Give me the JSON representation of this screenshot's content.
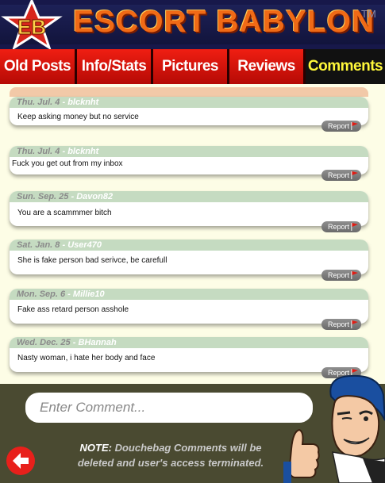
{
  "header": {
    "logo_text": "EB",
    "brand": "ESCORT BABYLON",
    "tm": "TM"
  },
  "tabs": [
    {
      "label": "Old Posts"
    },
    {
      "label": "Info/Stats"
    },
    {
      "label": "Pictures"
    },
    {
      "label": "Reviews"
    },
    {
      "label": "Comments",
      "active": true
    }
  ],
  "comments": [
    {
      "date": "Thu. Jul. 4",
      "dash": " - ",
      "user": "blcknht",
      "text": "Keep asking money but no service",
      "report": "Report"
    },
    {
      "date": "Thu. Jul. 4",
      "dash": " - ",
      "user": "blcknht",
      "text": "Fuck you get out from my inbox",
      "report": "Report"
    },
    {
      "date": "Sun. Sep. 25",
      "dash": " - ",
      "user": "Davon82",
      "text": "You are a scammmer bitch",
      "report": "Report"
    },
    {
      "date": "Sat. Jan. 8",
      "dash": " - ",
      "user": "User470",
      "text": "She is fake person bad serivce, be carefull",
      "report": "Report"
    },
    {
      "date": "Mon. Sep. 6",
      "dash": " - ",
      "user": "Millie10",
      "text": "Fake ass retard person asshole",
      "report": "Report"
    },
    {
      "date": "Wed. Dec. 25",
      "dash": " - ",
      "user": "BHannah",
      "text": "Nasty woman, i hate her body and face",
      "report": "Report"
    }
  ],
  "footer": {
    "input_placeholder": "Enter Comment...",
    "note_label": "NOTE:",
    "note_line1": "Douchebag Comments will be",
    "note_line2": "deleted and user's access terminated."
  },
  "colors": {
    "tab_red": "#e0160f",
    "active_tab_text": "#fff83a",
    "header_bg": "#17184a",
    "card_header": "#c5dbc1",
    "footer_bg": "#4a4a31"
  },
  "icons": [
    "eb-star-logo-icon",
    "report-flag-icon",
    "back-arrow-icon",
    "winking-mascot-thumbs-up"
  ]
}
